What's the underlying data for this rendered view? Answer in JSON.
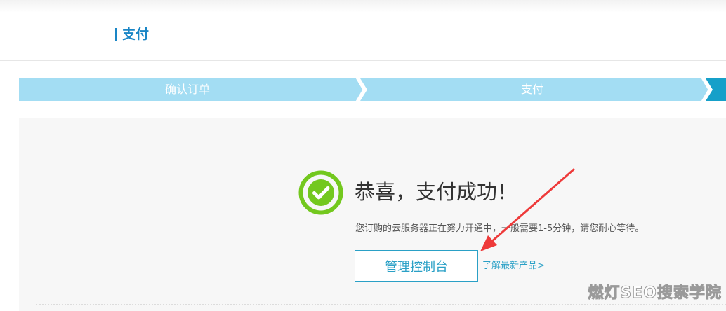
{
  "header": {
    "title": "支付"
  },
  "steps": [
    {
      "label": "确认订单",
      "state": "completed"
    },
    {
      "label": "支付",
      "state": "completed"
    },
    {
      "label": "",
      "state": "current"
    }
  ],
  "colors": {
    "brand": "#1a86c6",
    "step_light": "#a3ddf3",
    "step_active": "#16a0c9",
    "success_green": "#73c81e",
    "link": "#2aa0c6",
    "annotation_red": "#ee3a3a"
  },
  "result": {
    "icon": "check-circle-icon",
    "title": "恭喜，支付成功！",
    "description": "您订购的云服务器正在努力开通中，一般需要1-5分钟，请您耐心等待。",
    "console_button_label": "管理控制台",
    "learn_link_label": "了解最新产品>"
  },
  "watermark": "燃灯SEO搜索学院"
}
